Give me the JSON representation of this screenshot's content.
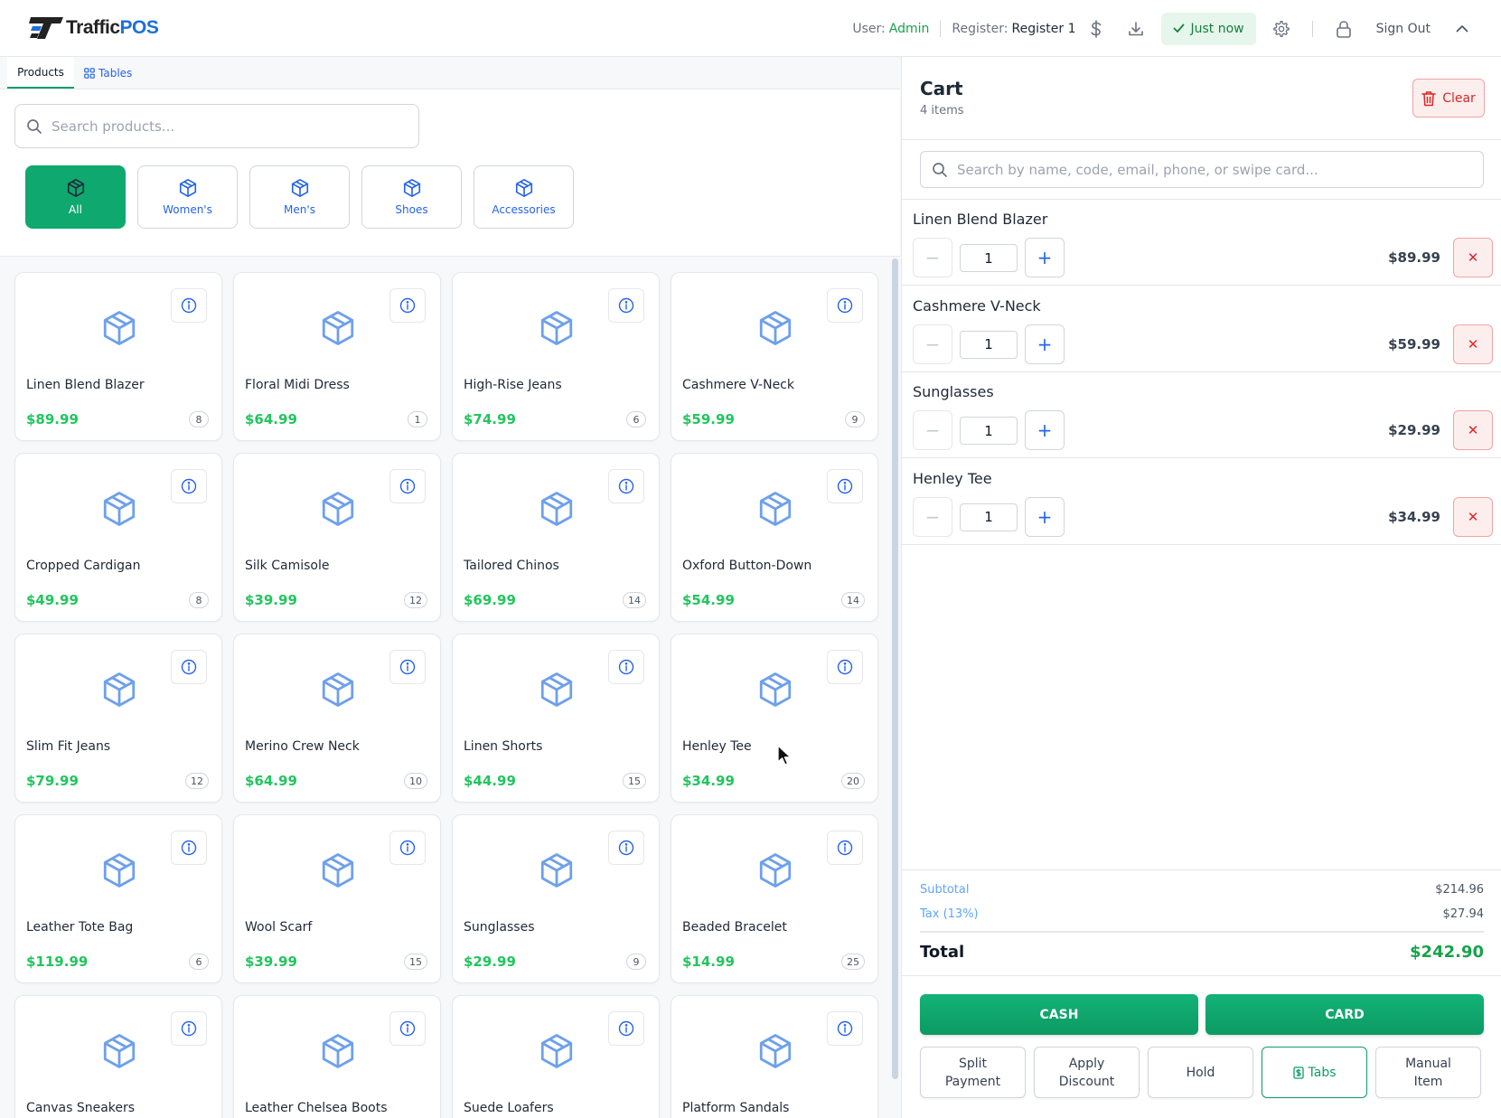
{
  "header": {
    "logo_a": "Traffic",
    "logo_b": "POS",
    "user_label": "User:",
    "user_value": "Admin",
    "register_label": "Register:",
    "register_value": "Register 1",
    "sync_status": "Just now",
    "sign_out": "Sign Out",
    "icons": [
      "dollar-icon",
      "download-icon",
      "check-icon",
      "gear-icon",
      "lock-icon",
      "chevron-up-icon"
    ]
  },
  "tabs": {
    "products": "Products",
    "tables": "Tables"
  },
  "search": {
    "placeholder": "Search products..."
  },
  "categories": [
    {
      "label": "All",
      "active": true
    },
    {
      "label": "Women's",
      "active": false
    },
    {
      "label": "Men's",
      "active": false
    },
    {
      "label": "Shoes",
      "active": false
    },
    {
      "label": "Accessories",
      "active": false
    }
  ],
  "products": [
    {
      "name": "Linen Blend Blazer",
      "price": "$89.99",
      "stock": "8"
    },
    {
      "name": "Floral Midi Dress",
      "price": "$64.99",
      "stock": "1"
    },
    {
      "name": "High-Rise Jeans",
      "price": "$74.99",
      "stock": "6"
    },
    {
      "name": "Cashmere V-Neck",
      "price": "$59.99",
      "stock": "9"
    },
    {
      "name": "Cropped Cardigan",
      "price": "$49.99",
      "stock": "8"
    },
    {
      "name": "Silk Camisole",
      "price": "$39.99",
      "stock": "12"
    },
    {
      "name": "Tailored Chinos",
      "price": "$69.99",
      "stock": "14"
    },
    {
      "name": "Oxford Button-Down",
      "price": "$54.99",
      "stock": "14"
    },
    {
      "name": "Slim Fit Jeans",
      "price": "$79.99",
      "stock": "12"
    },
    {
      "name": "Merino Crew Neck",
      "price": "$64.99",
      "stock": "10"
    },
    {
      "name": "Linen Shorts",
      "price": "$44.99",
      "stock": "15"
    },
    {
      "name": "Henley Tee",
      "price": "$34.99",
      "stock": "20"
    },
    {
      "name": "Leather Tote Bag",
      "price": "$119.99",
      "stock": "6"
    },
    {
      "name": "Wool Scarf",
      "price": "$39.99",
      "stock": "15"
    },
    {
      "name": "Sunglasses",
      "price": "$29.99",
      "stock": "9"
    },
    {
      "name": "Beaded Bracelet",
      "price": "$14.99",
      "stock": "25"
    },
    {
      "name": "Canvas Sneakers",
      "price": "",
      "stock": ""
    },
    {
      "name": "Leather Chelsea Boots",
      "price": "",
      "stock": ""
    },
    {
      "name": "Suede Loafers",
      "price": "",
      "stock": ""
    },
    {
      "name": "Platform Sandals",
      "price": "",
      "stock": ""
    }
  ],
  "cart": {
    "title": "Cart",
    "count": "4 items",
    "clear_label": "Clear",
    "customer_search_placeholder": "Search by name, code, email, phone, or swipe card...",
    "lines": [
      {
        "name": "Linen Blend Blazer",
        "qty": "1",
        "price": "$89.99"
      },
      {
        "name": "Cashmere V-Neck",
        "qty": "1",
        "price": "$59.99"
      },
      {
        "name": "Sunglasses",
        "qty": "1",
        "price": "$29.99"
      },
      {
        "name": "Henley Tee",
        "qty": "1",
        "price": "$34.99"
      }
    ],
    "subtotal_label": "Subtotal",
    "subtotal": "$214.96",
    "tax_label": "Tax (13%)",
    "tax": "$27.94",
    "total_label": "Total",
    "total": "$242.90",
    "cash_label": "CASH",
    "card_label": "CARD",
    "actions": {
      "split_1": "Split",
      "split_2": "Payment",
      "discount_1": "Apply",
      "discount_2": "Discount",
      "hold": "Hold",
      "tabs": "Tabs",
      "manual_1": "Manual",
      "manual_2": "Item"
    }
  },
  "colors": {
    "accent_green": "#0fa86e",
    "price_green": "#22c55e",
    "link_blue": "#2563eb",
    "danger_red": "#dc2626"
  }
}
